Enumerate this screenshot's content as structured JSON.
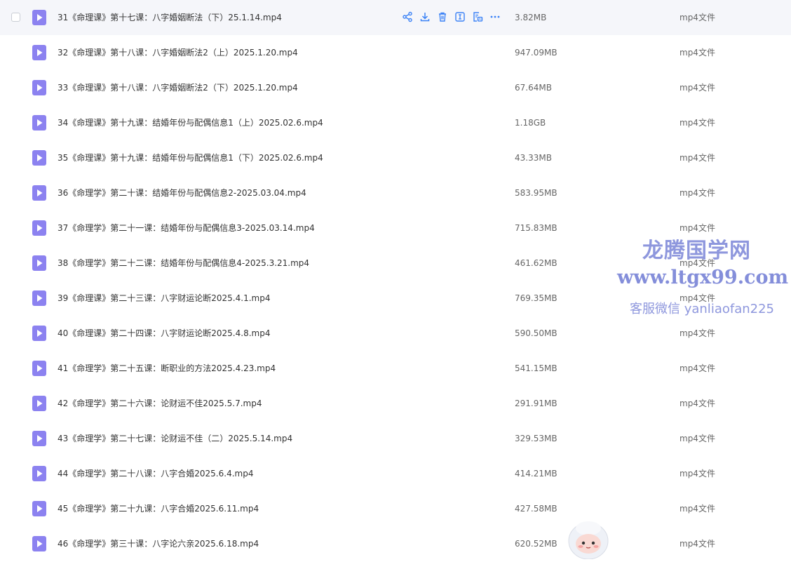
{
  "hover_actions": [
    {
      "icon": "share-icon",
      "label": "share"
    },
    {
      "icon": "download-icon",
      "label": "download"
    },
    {
      "icon": "delete-icon",
      "label": "delete"
    },
    {
      "icon": "rename-icon",
      "label": "rename"
    },
    {
      "icon": "subtitle-icon",
      "label": "subtitle"
    },
    {
      "icon": "more-icon",
      "label": "more"
    }
  ],
  "files": [
    {
      "name": "31《命理课》第十七课：八字婚姻断法（下）25.1.14.mp4",
      "size": "3.82MB",
      "type": "mp4文件"
    },
    {
      "name": "32《命理课》第十八课：八字婚姻断法2（上）2025.1.20.mp4",
      "size": "947.09MB",
      "type": "mp4文件"
    },
    {
      "name": "33《命理课》第十八课：八字婚姻断法2（下）2025.1.20.mp4",
      "size": "67.64MB",
      "type": "mp4文件"
    },
    {
      "name": "34《命理课》第十九课：结婚年份与配偶信息1（上）2025.02.6.mp4",
      "size": "1.18GB",
      "type": "mp4文件"
    },
    {
      "name": "35《命理课》第十九课：结婚年份与配偶信息1（下）2025.02.6.mp4",
      "size": "43.33MB",
      "type": "mp4文件"
    },
    {
      "name": "36《命理学》第二十课：结婚年份与配偶信息2-2025.03.04.mp4",
      "size": "583.95MB",
      "type": "mp4文件"
    },
    {
      "name": "37《命理学》第二十一课：结婚年份与配偶信息3-2025.03.14.mp4",
      "size": "715.83MB",
      "type": "mp4文件"
    },
    {
      "name": "38《命理学》第二十二课：结婚年份与配偶信息4-2025.3.21.mp4",
      "size": "461.62MB",
      "type": "mp4文件"
    },
    {
      "name": "39《命理课》第二十三课：八字财运论断2025.4.1.mp4",
      "size": "769.35MB",
      "type": "mp4文件"
    },
    {
      "name": "40《命理课》第二十四课：八字财运论断2025.4.8.mp4",
      "size": "590.50MB",
      "type": "mp4文件"
    },
    {
      "name": "41《命理学》第二十五课：断职业的方法2025.4.23.mp4",
      "size": "541.15MB",
      "type": "mp4文件"
    },
    {
      "name": "42《命理学》第二十六课：论财运不佳2025.5.7.mp4",
      "size": "291.91MB",
      "type": "mp4文件"
    },
    {
      "name": "43《命理学》第二十七课：论财运不佳（二）2025.5.14.mp4",
      "size": "329.53MB",
      "type": "mp4文件"
    },
    {
      "name": "44《命理学》第二十八课：八字合婚2025.6.4.mp4",
      "size": "414.21MB",
      "type": "mp4文件"
    },
    {
      "name": "45《命理学》第二十九课：八字合婚2025.6.11.mp4",
      "size": "427.58MB",
      "type": "mp4文件"
    },
    {
      "name": "46《命理学》第三十课：八字论六亲2025.6.18.mp4",
      "size": "620.52MB",
      "type": "mp4文件"
    }
  ],
  "watermark": {
    "title": "龙腾国学网",
    "url": "www.ltgx99.com",
    "contact": "客服微信 yanliaofan225"
  },
  "colors": {
    "video_icon": "#8c82f0",
    "action_icon": "#3b82f6",
    "hover_row": "#f5f6fa",
    "watermark": "#7b86d8"
  }
}
